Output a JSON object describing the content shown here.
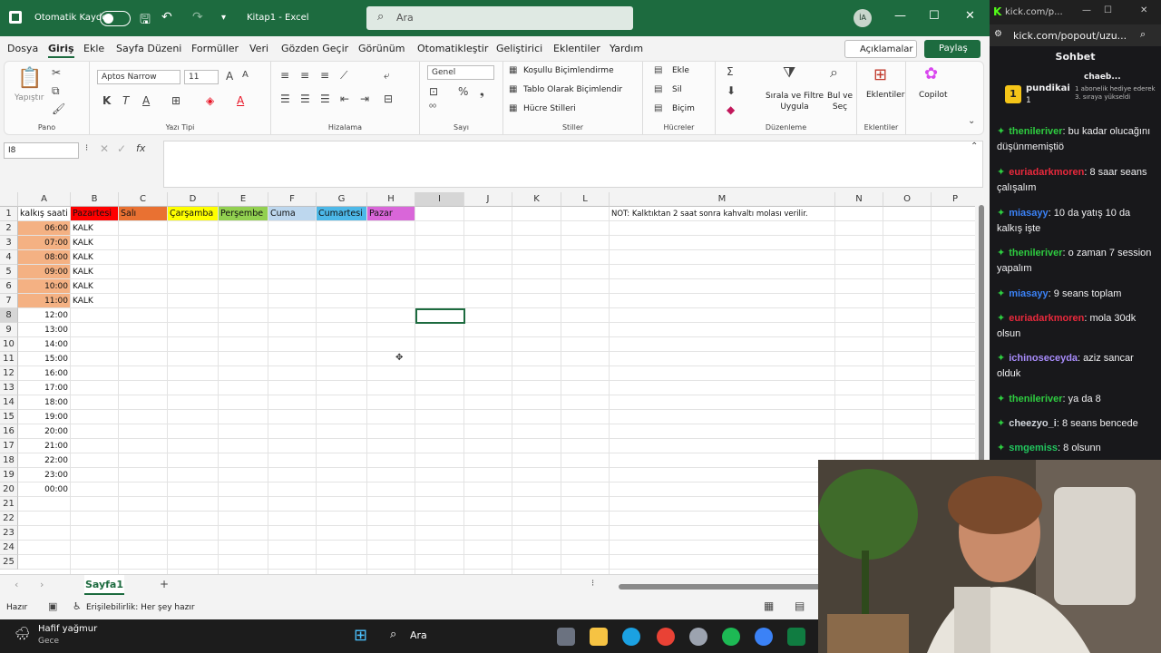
{
  "titlebar": {
    "autosave_label": "Otomatik Kaydet",
    "doc_title": "Kitap1  -  Excel",
    "search_placeholder": "Ara",
    "user_initials": "İA"
  },
  "menu": {
    "tabs": [
      "Dosya",
      "Giriş",
      "Ekle",
      "Sayfa Düzeni",
      "Formüller",
      "Veri",
      "Gözden Geçir",
      "Görünüm",
      "Otomatikleştir",
      "Geliştirici",
      "Eklentiler",
      "Yardım"
    ],
    "active": "Giriş",
    "comments_label": "Açıklamalar",
    "share_label": "Paylaş"
  },
  "ribbon": {
    "paste_label": "Yapıştır",
    "clipboard_label": "Pano",
    "font_name": "Aptos Narrow",
    "font_size": "11",
    "font_label": "Yazı Tipi",
    "alignment_label": "Hizalama",
    "number_format": "Genel",
    "number_label": "Sayı",
    "cond_format_label": "Koşullu Biçimlendirme",
    "table_format_label": "Tablo Olarak Biçimlendir",
    "cell_styles_label": "Hücre Stilleri",
    "styles_label": "Stiller",
    "insert_label": "Ekle",
    "delete_label": "Sil",
    "format_label": "Biçim",
    "cells_label": "Hücreler",
    "sort_label": "Sırala ve Filtre Uygula",
    "find_label": "Bul ve Seç",
    "editing_label": "Düzenleme",
    "addins_label": "Eklentiler",
    "addins_group_label": "Eklentiler",
    "copilot_label": "Copilot"
  },
  "formula_bar": {
    "name_box": "I8",
    "fx": "fx",
    "formula": ""
  },
  "sheet": {
    "columns": [
      "A",
      "B",
      "C",
      "D",
      "E",
      "F",
      "G",
      "H",
      "I",
      "J",
      "K",
      "L",
      "M",
      "N",
      "O",
      "P"
    ],
    "rows": [
      "1",
      "2",
      "3",
      "4",
      "5",
      "6",
      "7",
      "8",
      "9",
      "10",
      "11",
      "12",
      "13",
      "14",
      "15",
      "16",
      "17",
      "18",
      "19",
      "20",
      "21",
      "22",
      "23",
      "24",
      "25"
    ],
    "header_row": [
      {
        "text": "kalkış saati",
        "bg": "#ffffff"
      },
      {
        "text": "Pazartesi",
        "bg": "#ff0000"
      },
      {
        "text": "Salı",
        "bg": "#e97132"
      },
      {
        "text": "Çarşamba",
        "bg": "#ffff00"
      },
      {
        "text": "Perşembe",
        "bg": "#92d050"
      },
      {
        "text": "Cuma",
        "bg": "#bdd7ee"
      },
      {
        "text": "Cumartesi",
        "bg": "#4db8e8"
      },
      {
        "text": "Pazar",
        "bg": "#d966d9"
      }
    ],
    "times": [
      "06:00",
      "07:00",
      "08:00",
      "09:00",
      "10:00",
      "11:00",
      "12:00",
      "13:00",
      "14:00",
      "15:00",
      "16:00",
      "17:00",
      "18:00",
      "19:00",
      "20:00",
      "21:00",
      "22:00",
      "23:00",
      "00:00"
    ],
    "highlighted_time_count": 6,
    "time_highlight_color": "#f4b183",
    "kalk": [
      "KALK",
      "KALK",
      "KALK",
      "KALK",
      "KALK",
      "KALK"
    ],
    "note": "NOT: Kalktıktan 2 saat sonra kahvaltı molası verilir.",
    "selected_cell": "I8",
    "sheet_tab": "Sayfa1"
  },
  "status": {
    "ready": "Hazır",
    "accessibility": "Erişilebilirlik: Her şey hazır"
  },
  "chat": {
    "url_short": "kick.com/p...",
    "url": "kick.com/popout/uzu...",
    "title": "Sohbet",
    "pinned_user": "pundikai",
    "pinned_user_count": "1",
    "pinned_user2": "chaeb...",
    "pinned_gift": "1 abonelik hediye ederek 3. sıraya yükseldi",
    "messages": [
      {
        "user": "thenileriver",
        "color": "#2ecc40",
        "text": "bu kadar olucağını düşünmemiştiö"
      },
      {
        "user": "euriadarkmoren",
        "color": "#e8293c",
        "text": "8 saar seans çalışalım"
      },
      {
        "user": "miasayy",
        "color": "#3b82f6",
        "text": "10 da yatış 10 da kalkış işte"
      },
      {
        "user": "thenileriver",
        "color": "#2ecc40",
        "text": "o zaman 7 session yapalım"
      },
      {
        "user": "miasayy",
        "color": "#3b82f6",
        "text": "9 seans toplam"
      },
      {
        "user": "euriadarkmoren",
        "color": "#e8293c",
        "text": "mola 30dk olsun"
      },
      {
        "user": "ichinoseceyda",
        "color": "#a78bfa",
        "text": "aziz sancar olduk"
      },
      {
        "user": "thenileriver",
        "color": "#2ecc40",
        "text": "ya da 8"
      },
      {
        "user": "cheezyo_i",
        "color": "#d1d5db",
        "text": "8 seans bencede"
      },
      {
        "user": "smgemiss",
        "color": "#22c55e",
        "text": "8 olsunn"
      }
    ]
  },
  "taskbar": {
    "weather": "Hafif yağmur",
    "weather_sub": "Gece",
    "search": "Ara"
  }
}
